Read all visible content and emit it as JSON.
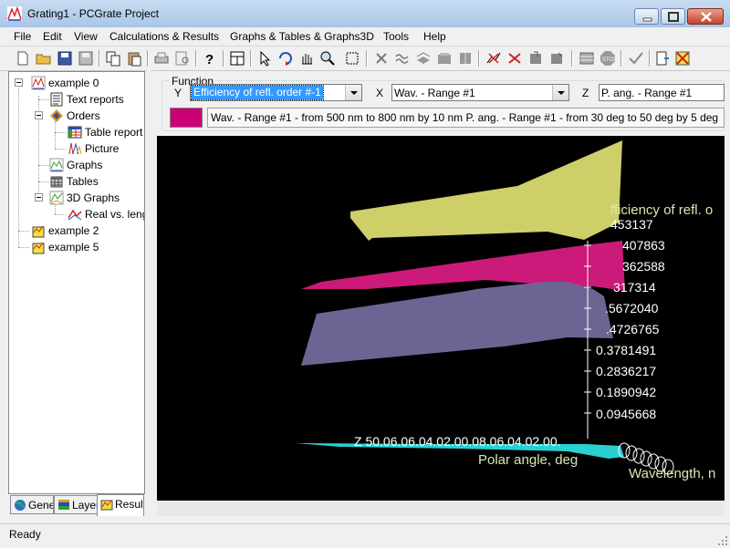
{
  "window": {
    "title": "Grating1 - PCGrate Project"
  },
  "menu": [
    "File",
    "Edit",
    "View",
    "Calculations & Results",
    "Graphs & Tables & Graphs3D",
    "Tools",
    "Help"
  ],
  "toolbar_icons": [
    "new-file-icon",
    "open-folder-icon",
    "save-icon",
    "save-all-icon",
    "copy-icon",
    "paste-icon",
    "print-icon",
    "print-preview-icon",
    "help-icon",
    "layout-icon",
    "pointer-icon",
    "rotate-icon",
    "pan-hand-icon",
    "zoom-icon",
    "fit-view-icon",
    "delete-icon",
    "wave-icon",
    "layers-icon",
    "stack-icon",
    "book-icon",
    "graph-x-icon",
    "grid-x-icon",
    "export-icon",
    "export2-icon",
    "table-icon",
    "stop-icon",
    "check-calc-icon",
    "report-icon",
    "clear-icon"
  ],
  "tree": {
    "nodes": [
      {
        "label": "example 0",
        "icon": "graph-project-icon"
      },
      {
        "label": "Text reports",
        "icon": "text-report-icon"
      },
      {
        "label": "Orders",
        "icon": "orders-icon"
      },
      {
        "label": "Table report",
        "icon": "table-report-icon"
      },
      {
        "label": "Picture",
        "icon": "picture-icon"
      },
      {
        "label": "Graphs",
        "icon": "graphs-icon"
      },
      {
        "label": "Tables",
        "icon": "tables-icon"
      },
      {
        "label": "3D Graphs",
        "icon": "3d-graphs-icon"
      },
      {
        "label": "Real vs. leng",
        "icon": "3d-graph-item-icon"
      },
      {
        "label": "example 2",
        "icon": "project-icon"
      },
      {
        "label": "example 5",
        "icon": "project-icon"
      }
    ]
  },
  "bottom_tabs": [
    {
      "label": "Gene",
      "icon": "globe-icon"
    },
    {
      "label": "Layer",
      "icon": "layers-tab-icon"
    },
    {
      "label": "Result",
      "icon": "result-icon"
    }
  ],
  "function": {
    "title": "Function",
    "y_label": "Y",
    "y_value": "Efficiency of refl. order #-1",
    "x_label": "X",
    "x_value": "Wav. - Range #1",
    "z_label": "Z",
    "z_value": "P. ang. - Range #1",
    "description": "Wav. - Range #1 - from 500 nm to 800 nm by 10 nm  P. ang. - Range #1 - from 30 deg to 50 deg by 5 deg",
    "swatch_color": "#cc0077"
  },
  "graph3d": {
    "y_axis_title": "fficiency of refl. o",
    "y_ticks": [
      "453137",
      "407863",
      "362588",
      "317314",
      ".5672040",
      ".4726765",
      "0.3781491",
      "0.2836217",
      "0.1890942",
      "0.0945668"
    ],
    "z_axis_row": "Z 50.06.06.04.02.00.08.06.04.02.00.",
    "z_axis_title": "Polar angle, deg",
    "x_axis_title": "Wavelength, n",
    "surface_colors": [
      "#cfcf6a",
      "#cc1a7a",
      "#6e6494",
      "#2ad0d0"
    ]
  },
  "status": {
    "text": "Ready"
  }
}
